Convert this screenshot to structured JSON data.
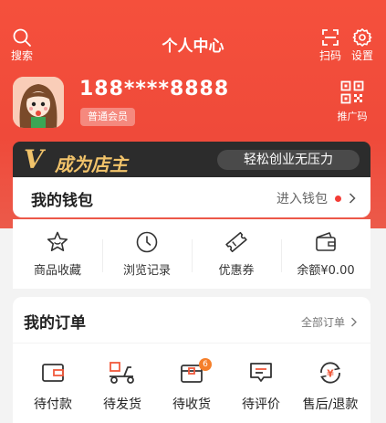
{
  "header": {
    "title": "个人中心",
    "search_label": "搜索",
    "scan_label": "扫码",
    "settings_label": "设置",
    "search_icon": "search-icon",
    "scan_icon": "scan-icon",
    "settings_icon": "gear-icon"
  },
  "profile": {
    "phone": "188****8888",
    "member_level": "普通会员",
    "promo_code_label": "推广码",
    "promo_icon": "qr-code-icon"
  },
  "shop_banner": {
    "logo_letter": "V",
    "title": "成为店主",
    "slogan": "轻松创业无压力"
  },
  "wallet": {
    "title": "我的钱包",
    "link": "进入钱包"
  },
  "quick_actions": [
    {
      "label": "商品收藏",
      "icon": "star-icon"
    },
    {
      "label": "浏览记录",
      "icon": "clock-icon"
    },
    {
      "label": "优惠券",
      "icon": "ticket-icon"
    },
    {
      "label": "余额¥0.00",
      "icon": "wallet-icon"
    }
  ],
  "orders": {
    "title": "我的订单",
    "all_link": "全部订单",
    "items": [
      {
        "label": "待付款",
        "icon": "card-icon",
        "badge": ""
      },
      {
        "label": "待发货",
        "icon": "delivery-scooter-icon",
        "badge": ""
      },
      {
        "label": "待收货",
        "icon": "package-icon",
        "badge": "6"
      },
      {
        "label": "待评价",
        "icon": "comment-icon",
        "badge": ""
      },
      {
        "label": "售后/退款",
        "icon": "refund-icon",
        "badge": ""
      }
    ]
  },
  "colors": {
    "brand_red": "#f5503c",
    "gold": "#f1c36a",
    "banner_dark": "#2c2c2c",
    "badge_orange": "#f57f2b"
  }
}
